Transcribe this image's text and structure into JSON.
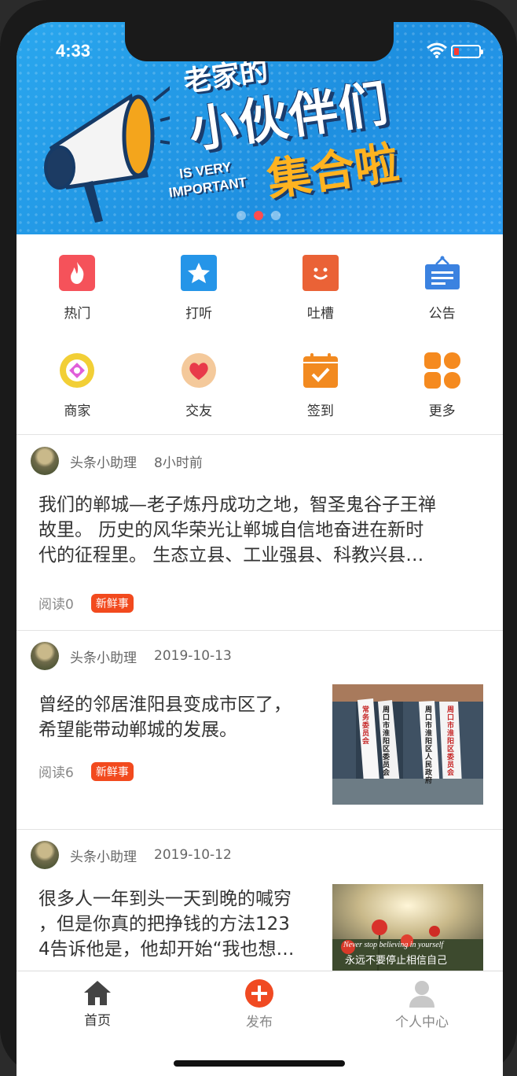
{
  "status": {
    "time": "4:33"
  },
  "banner": {
    "text_top": "老家的",
    "text_main": "小伙伴们",
    "text_en_1": "IS VERY",
    "text_en_2": "IMPORTANT",
    "text_sub": "集合啦",
    "slides": 3,
    "active_slide": 2
  },
  "menu": [
    {
      "label": "热门",
      "icon": "fire-icon",
      "color": "#f5525a"
    },
    {
      "label": "打听",
      "icon": "star-icon",
      "color": "#2595e8"
    },
    {
      "label": "吐槽",
      "icon": "smile-icon",
      "color": "#ea6236"
    },
    {
      "label": "公告",
      "icon": "notice-icon",
      "color": "#3b82e0"
    },
    {
      "label": "商家",
      "icon": "shop-icon",
      "color": "#f2cf36"
    },
    {
      "label": "交友",
      "icon": "heart-icon",
      "color": "#e83b4a"
    },
    {
      "label": "签到",
      "icon": "calendar-check-icon",
      "color": "#f28a20"
    },
    {
      "label": "更多",
      "icon": "grid-icon",
      "color": "#f58a1f"
    }
  ],
  "posts": [
    {
      "author": "头条小助理",
      "time": "8小时前",
      "text_lines": [
        "我们的郸城—老子炼丹成功之地，智圣鬼谷子王禅",
        "故里。 历史的风华荣光让郸城自信地奋进在新时",
        "代的征程里。 生态立县、工业强县、科教兴县…"
      ],
      "reads": "阅读0",
      "tag": "新鲜事"
    },
    {
      "author": "头条小助理",
      "time": "2019-10-13",
      "text_lines": [
        "曾经的邻居淮阳县变成市区了，",
        "希望能带动郸城的发展。"
      ],
      "reads": "阅读6",
      "tag": "新鲜事",
      "thumb_signs": [
        "周口市淮阳区委员会",
        "周口市淮阳区人民政府",
        "常务委员会"
      ]
    },
    {
      "author": "头条小助理",
      "time": "2019-10-12",
      "text_lines": [
        "很多人一年到头一天到晚的喊穷",
        "，但是你真的把挣钱的方法123",
        "4告诉他是，他却开始“我也想…"
      ],
      "thumb_caption_en": "Never stop believing in yourself",
      "thumb_caption_cn": "永远不要停止相信自己"
    }
  ],
  "tabbar": [
    {
      "label": "首页",
      "icon": "home-icon"
    },
    {
      "label": "发布",
      "icon": "plus-circle-icon"
    },
    {
      "label": "个人中心",
      "icon": "user-icon"
    }
  ]
}
